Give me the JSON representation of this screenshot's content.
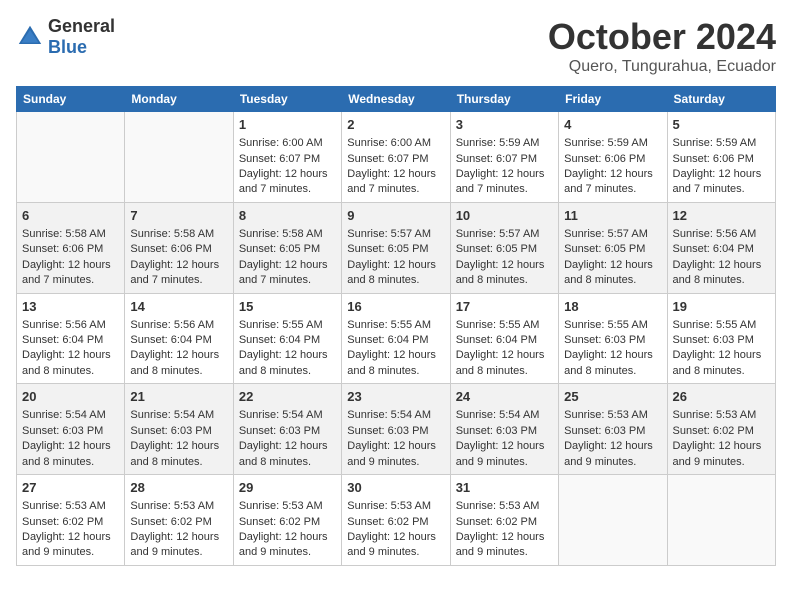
{
  "header": {
    "logo_general": "General",
    "logo_blue": "Blue",
    "title": "October 2024",
    "location": "Quero, Tungurahua, Ecuador"
  },
  "days_of_week": [
    "Sunday",
    "Monday",
    "Tuesday",
    "Wednesday",
    "Thursday",
    "Friday",
    "Saturday"
  ],
  "weeks": [
    [
      {
        "day": "",
        "content": ""
      },
      {
        "day": "",
        "content": ""
      },
      {
        "day": "1",
        "content": "Sunrise: 6:00 AM\nSunset: 6:07 PM\nDaylight: 12 hours and 7 minutes."
      },
      {
        "day": "2",
        "content": "Sunrise: 6:00 AM\nSunset: 6:07 PM\nDaylight: 12 hours and 7 minutes."
      },
      {
        "day": "3",
        "content": "Sunrise: 5:59 AM\nSunset: 6:07 PM\nDaylight: 12 hours and 7 minutes."
      },
      {
        "day": "4",
        "content": "Sunrise: 5:59 AM\nSunset: 6:06 PM\nDaylight: 12 hours and 7 minutes."
      },
      {
        "day": "5",
        "content": "Sunrise: 5:59 AM\nSunset: 6:06 PM\nDaylight: 12 hours and 7 minutes."
      }
    ],
    [
      {
        "day": "6",
        "content": "Sunrise: 5:58 AM\nSunset: 6:06 PM\nDaylight: 12 hours and 7 minutes."
      },
      {
        "day": "7",
        "content": "Sunrise: 5:58 AM\nSunset: 6:06 PM\nDaylight: 12 hours and 7 minutes."
      },
      {
        "day": "8",
        "content": "Sunrise: 5:58 AM\nSunset: 6:05 PM\nDaylight: 12 hours and 7 minutes."
      },
      {
        "day": "9",
        "content": "Sunrise: 5:57 AM\nSunset: 6:05 PM\nDaylight: 12 hours and 8 minutes."
      },
      {
        "day": "10",
        "content": "Sunrise: 5:57 AM\nSunset: 6:05 PM\nDaylight: 12 hours and 8 minutes."
      },
      {
        "day": "11",
        "content": "Sunrise: 5:57 AM\nSunset: 6:05 PM\nDaylight: 12 hours and 8 minutes."
      },
      {
        "day": "12",
        "content": "Sunrise: 5:56 AM\nSunset: 6:04 PM\nDaylight: 12 hours and 8 minutes."
      }
    ],
    [
      {
        "day": "13",
        "content": "Sunrise: 5:56 AM\nSunset: 6:04 PM\nDaylight: 12 hours and 8 minutes."
      },
      {
        "day": "14",
        "content": "Sunrise: 5:56 AM\nSunset: 6:04 PM\nDaylight: 12 hours and 8 minutes."
      },
      {
        "day": "15",
        "content": "Sunrise: 5:55 AM\nSunset: 6:04 PM\nDaylight: 12 hours and 8 minutes."
      },
      {
        "day": "16",
        "content": "Sunrise: 5:55 AM\nSunset: 6:04 PM\nDaylight: 12 hours and 8 minutes."
      },
      {
        "day": "17",
        "content": "Sunrise: 5:55 AM\nSunset: 6:04 PM\nDaylight: 12 hours and 8 minutes."
      },
      {
        "day": "18",
        "content": "Sunrise: 5:55 AM\nSunset: 6:03 PM\nDaylight: 12 hours and 8 minutes."
      },
      {
        "day": "19",
        "content": "Sunrise: 5:55 AM\nSunset: 6:03 PM\nDaylight: 12 hours and 8 minutes."
      }
    ],
    [
      {
        "day": "20",
        "content": "Sunrise: 5:54 AM\nSunset: 6:03 PM\nDaylight: 12 hours and 8 minutes."
      },
      {
        "day": "21",
        "content": "Sunrise: 5:54 AM\nSunset: 6:03 PM\nDaylight: 12 hours and 8 minutes."
      },
      {
        "day": "22",
        "content": "Sunrise: 5:54 AM\nSunset: 6:03 PM\nDaylight: 12 hours and 8 minutes."
      },
      {
        "day": "23",
        "content": "Sunrise: 5:54 AM\nSunset: 6:03 PM\nDaylight: 12 hours and 9 minutes."
      },
      {
        "day": "24",
        "content": "Sunrise: 5:54 AM\nSunset: 6:03 PM\nDaylight: 12 hours and 9 minutes."
      },
      {
        "day": "25",
        "content": "Sunrise: 5:53 AM\nSunset: 6:03 PM\nDaylight: 12 hours and 9 minutes."
      },
      {
        "day": "26",
        "content": "Sunrise: 5:53 AM\nSunset: 6:02 PM\nDaylight: 12 hours and 9 minutes."
      }
    ],
    [
      {
        "day": "27",
        "content": "Sunrise: 5:53 AM\nSunset: 6:02 PM\nDaylight: 12 hours and 9 minutes."
      },
      {
        "day": "28",
        "content": "Sunrise: 5:53 AM\nSunset: 6:02 PM\nDaylight: 12 hours and 9 minutes."
      },
      {
        "day": "29",
        "content": "Sunrise: 5:53 AM\nSunset: 6:02 PM\nDaylight: 12 hours and 9 minutes."
      },
      {
        "day": "30",
        "content": "Sunrise: 5:53 AM\nSunset: 6:02 PM\nDaylight: 12 hours and 9 minutes."
      },
      {
        "day": "31",
        "content": "Sunrise: 5:53 AM\nSunset: 6:02 PM\nDaylight: 12 hours and 9 minutes."
      },
      {
        "day": "",
        "content": ""
      },
      {
        "day": "",
        "content": ""
      }
    ]
  ]
}
